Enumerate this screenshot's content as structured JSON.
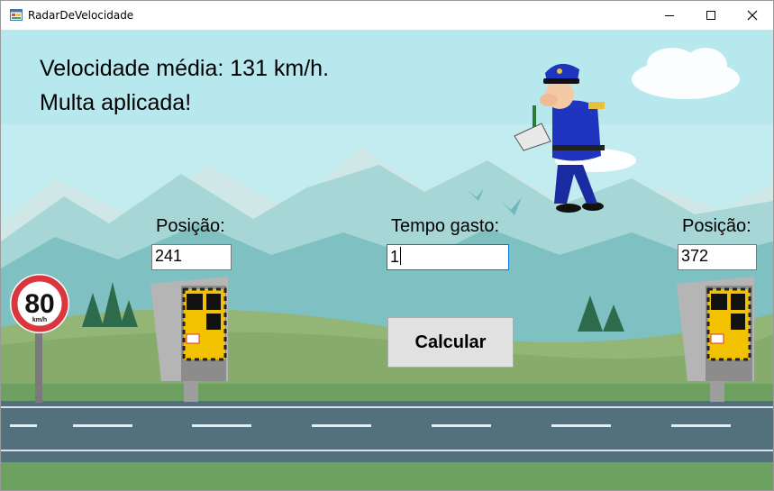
{
  "window": {
    "title": "RadarDeVelocidade"
  },
  "result": {
    "average_speed": "Velocidade média: 131 km/h.",
    "fine_message": "Multa aplicada!"
  },
  "form": {
    "pos1_label": "Posição:",
    "pos1_value": "241",
    "time_label": "Tempo gasto:",
    "time_value": "1",
    "pos2_label": "Posição:",
    "pos2_value": "372",
    "calculate_label": "Calcular"
  },
  "sign": {
    "speed": "80",
    "unit": "km/h"
  },
  "colors": {
    "sky": "#c2ecef",
    "road": "#53707d",
    "grass": "#6aa562",
    "sign_red": "#d9363e"
  }
}
